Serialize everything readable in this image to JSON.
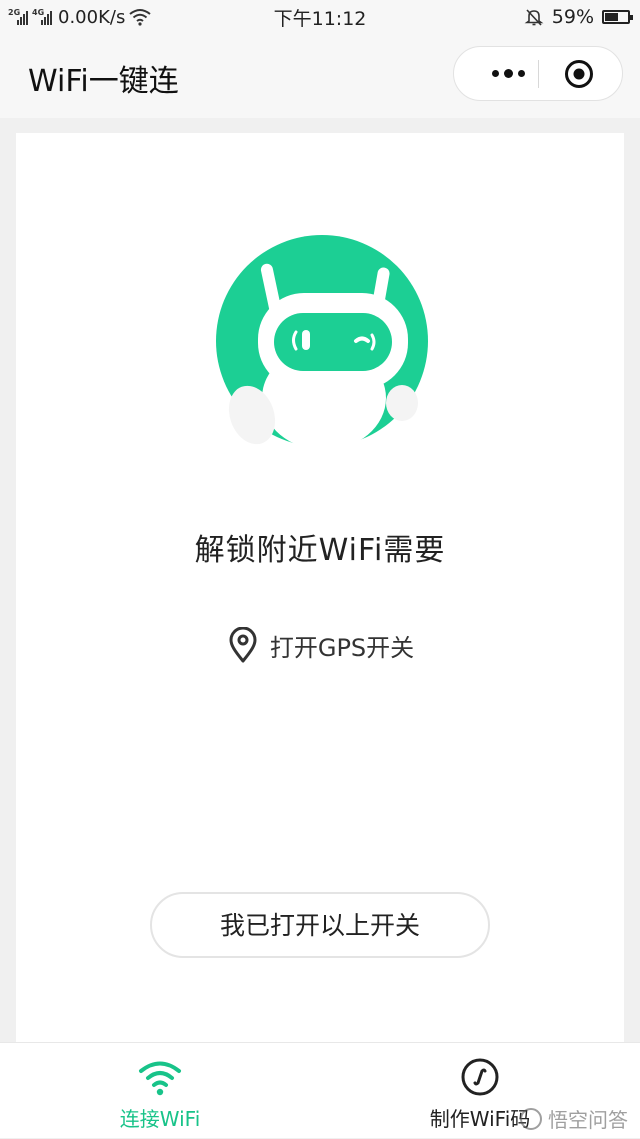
{
  "status_bar": {
    "network_1": "2G",
    "network_2": "4G",
    "speed": "0.00K/s",
    "time": "下午11:12",
    "battery_percent": "59%",
    "battery_level": 0.59,
    "icons": [
      "signal-icon",
      "signal-icon",
      "wifi-icon",
      "mute-bell-icon",
      "battery-icon"
    ]
  },
  "nav": {
    "title": "WiFi一键连",
    "more_icon": "more-dots-icon",
    "close_icon": "target-close-icon"
  },
  "main": {
    "illustration": "robot-mascot",
    "unlock_text": "解锁附近WiFi需要",
    "gps_icon": "location-pin-icon",
    "gps_text": "打开GPS开关",
    "confirm_button": "我已打开以上开关"
  },
  "tabbar": {
    "tabs": [
      {
        "label": "连接WiFi",
        "icon": "wifi-icon",
        "active": true
      },
      {
        "label": "制作WiFi码",
        "icon": "qrcode-circle-icon",
        "active": false
      }
    ]
  },
  "watermark": "悟空问答",
  "colors": {
    "accent": "#18c389",
    "mascot_green": "#1ccf94",
    "background": "#f0f0f0"
  }
}
